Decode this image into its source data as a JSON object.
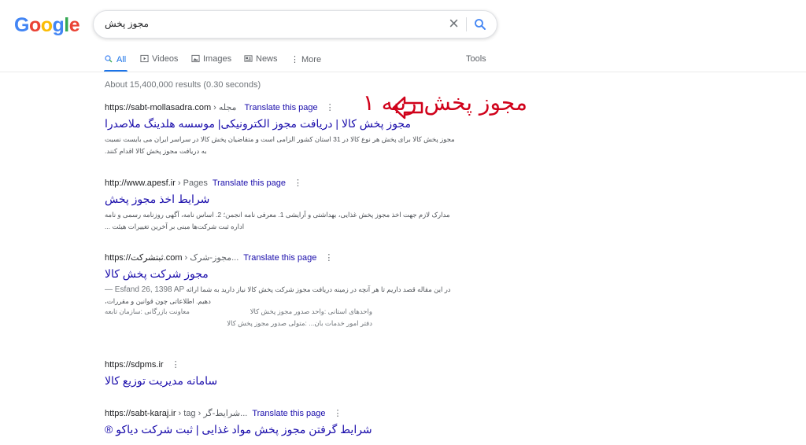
{
  "logo": {
    "letters": [
      "G",
      "o",
      "o",
      "g",
      "l",
      "e"
    ],
    "colors": [
      "#4285f4",
      "#ea4335",
      "#fbbc05",
      "#4285f4",
      "#34a853",
      "#ea4335"
    ]
  },
  "search": {
    "query": "مجوز پخش"
  },
  "tabs": [
    {
      "label": "All",
      "icon": "search-icon",
      "active": true
    },
    {
      "label": "Videos",
      "icon": "video-icon"
    },
    {
      "label": "Images",
      "icon": "image-icon"
    },
    {
      "label": "News",
      "icon": "news-icon"
    },
    {
      "label": "More",
      "icon": "more-vert-icon"
    }
  ],
  "tools_label": "Tools",
  "stats": "About 15,400,000 results (0.30 seconds)",
  "results": [
    {
      "url": "https://sabt-mollasadra.com",
      "breadcrumb": " › مجله",
      "translate": "Translate this page",
      "title": "مجوز پخش کالا | دریافت مجوز الکترونیکی| موسسه هلدینگ ملاصدرا",
      "snippet_line1": "مجوز پخش کالا برای پخش هر نوع کالا در 31 استان کشور الزامی است و متقاضیان پخش کالا در سراسر ایران می بایست نسبت",
      "snippet_line2": "به دریافت مجوز پخش کالا اقدام کنند."
    },
    {
      "url": "http://www.apesf.ir",
      "breadcrumb": " › Pages",
      "translate": "Translate this page",
      "title": "شرایط اخذ مجوز پخش",
      "snippet_line1": "مدارک لازم جهت اخذ مجوز پخش غذایی، بهداشتی و آرایشی 1. معرفی نامه انجمن؛ 2. اساس نامه، آگهی روزنامه رسمی و نامه",
      "snippet_line2": "اداره ثبت شرکت‌ها مبنی بر آخرین تغییرات هیئت ..."
    },
    {
      "url": "https://ثبتشرکت.com",
      "breadcrumb": " › مجوز-شرک...",
      "translate": "Translate this page",
      "title": "مجوز شرکت پخش کالا",
      "date": "Esfand 26, 1398 AP —",
      "snippet_line1": "در این مقاله قصد داریم تا هر آنچه در زمینه دریافت مجوز شرکت پخش کالا نیاز دارید به شما ارائه",
      "snippet_line2": "دهیم. اطلاعاتی چون قوانین و مقررات،",
      "sitelinks": [
        [
          "معاونت بازرگانی :سازمان تابعه",
          "واحدهای استانی :واحد صدور مجوز پخش کالا"
        ],
        [
          "",
          "دفتر امور خدمات بان... :متولی صدور مجوز پخش کالا"
        ]
      ]
    },
    {
      "url": "https://sdpms.ir",
      "title": "سامانه مدیریت توزیع کالا"
    },
    {
      "url": "https://sabt-karaj.ir",
      "breadcrumb": " › tag › شرایط-گر...",
      "translate": "Translate this page",
      "title": "شرایط گرفتن مجوز پخش مواد غذایی | ثبت شرکت دیاکو ®"
    }
  ],
  "annotation": {
    "text": "مجوز پخش رتبه ۱",
    "color": "#d0021b"
  }
}
